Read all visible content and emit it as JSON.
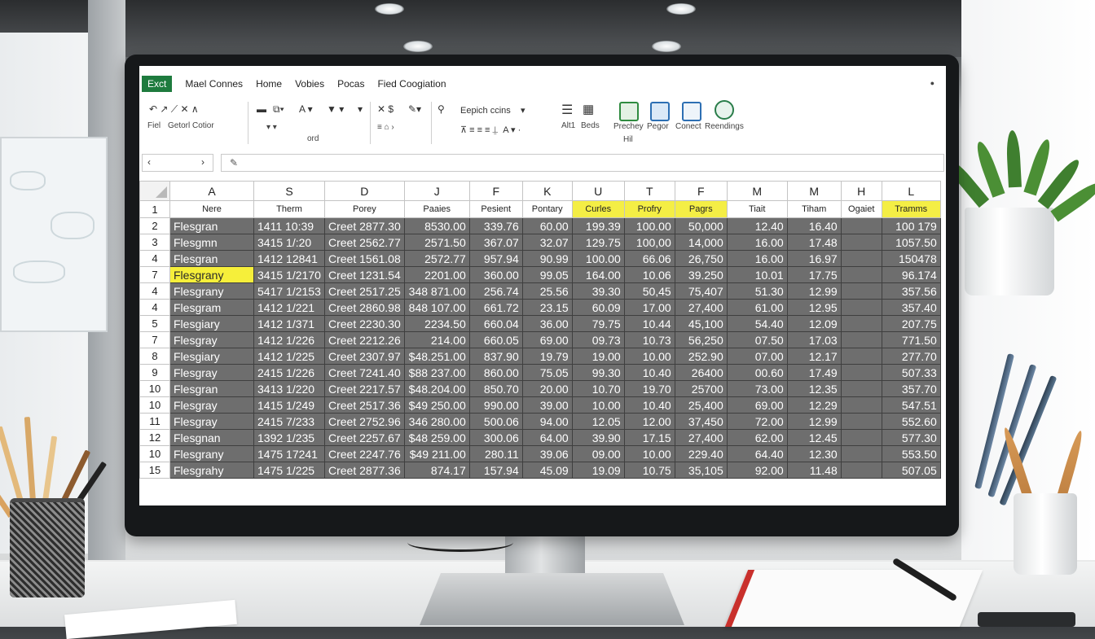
{
  "colors": {
    "sheet_cell": "#6e6e6e",
    "highlight": "#f4ee45",
    "excel_green": "#1e7b3e"
  },
  "ribbon": {
    "app_tab": "Exct",
    "tabs": [
      "Mael Connes",
      "Home",
      "Vobies",
      "Pocas",
      "Fied Coogiation"
    ],
    "left_labels": [
      "Fiel",
      "Getorl Cotior"
    ],
    "group_label": "ord",
    "font_box": "Eepich ccins",
    "right_buttons": [
      "Alt1",
      "Beds",
      "Prechey",
      "Pegor",
      "Conect",
      "Reendings"
    ],
    "sub_label": "Hil"
  },
  "name_box_nav": {
    "left": "‹",
    "right": "›"
  },
  "grid": {
    "column_letters": [
      "A",
      "S",
      "D",
      "J",
      "F",
      "K",
      "U",
      "T",
      "F",
      "M",
      "M",
      "H",
      "L"
    ],
    "headers": [
      "Nere",
      "Therm",
      "Porey",
      "Paaies",
      "Pesient",
      "Pontary",
      "Curles",
      "Profry",
      "Pagrs",
      "Tiait",
      "Tiham",
      "Ogaiet",
      "Tramms"
    ],
    "highlighted_headers": [
      6,
      7,
      8,
      12
    ],
    "header_row_num": "1",
    "rows": [
      {
        "num": "2",
        "cells": [
          "Flesgran",
          "1411 10:39",
          "Creet 2877.30",
          "8530.00",
          "339.76",
          "60.00",
          "199.39",
          "100.00",
          "50,000",
          "12.40",
          "16.40",
          "",
          "100 179"
        ]
      },
      {
        "num": "3",
        "cells": [
          "Flesgmn",
          "3415 1/:20",
          "Creet 2562.77",
          "2571.50",
          "367.07",
          "32.07",
          "129.75",
          "100,00",
          "14,000",
          "16.00",
          "17.48",
          "",
          "1057.50"
        ]
      },
      {
        "num": "4",
        "cells": [
          "Flesgran",
          "1412 12841",
          "Creet 1561.08",
          "2572.77",
          "957.94",
          "90.99",
          "100.00",
          "66.06",
          "26,750",
          "16.00",
          "16.97",
          "",
          "150478"
        ]
      },
      {
        "num": "7",
        "cells": [
          "Flesgrany",
          "3415 1/2170",
          "Creet 1231.54",
          "2201.00",
          "360.00",
          "99.05",
          "164.00",
          "10.06",
          "39.250",
          "10.01",
          "17.75",
          "",
          "96.174"
        ],
        "highlight_first": true
      },
      {
        "num": "4",
        "cells": [
          "Flesgrany",
          "5417 1/2153",
          "Creet 2517.25",
          "348 871.00",
          "256.74",
          "25.56",
          "39.30",
          "50,45",
          "75,407",
          "51.30",
          "12.99",
          "",
          "357.56"
        ]
      },
      {
        "num": "4",
        "cells": [
          "Flesgram",
          "1412 1/221",
          "Creet 2860.98",
          "848 107.00",
          "661.72",
          "23.15",
          "60.09",
          "17.00",
          "27,400",
          "61.00",
          "12.95",
          "",
          "357.40"
        ]
      },
      {
        "num": "5",
        "cells": [
          "Flesgiary",
          "1412 1/371",
          "Creet 2230.30",
          "2234.50",
          "660.04",
          "36.00",
          "79.75",
          "10.44",
          "45,100",
          "54.40",
          "12.09",
          "",
          "207.75"
        ]
      },
      {
        "num": "7",
        "cells": [
          "Flesgray",
          "1412 1/226",
          "Creet 2212.26",
          "214.00",
          "660.05",
          "69.00",
          "09.73",
          "10.73",
          "56,250",
          "07.50",
          "17.03",
          "",
          "771.50"
        ]
      },
      {
        "num": "8",
        "cells": [
          "Flesgiary",
          "1412 1/225",
          "Creet 2307.97",
          "$48.251.00",
          "837.90",
          "19.79",
          "19.00",
          "10.00",
          "252.90",
          "07.00",
          "12.17",
          "",
          "277.70"
        ]
      },
      {
        "num": "9",
        "cells": [
          "Flesgray",
          "2415 1/226",
          "Creet 7241.40",
          "$88 237.00",
          "860.00",
          "75.05",
          "99.30",
          "10.40",
          "26400",
          "00.60",
          "17.49",
          "",
          "507.33"
        ]
      },
      {
        "num": "10",
        "cells": [
          "Flesgran",
          "3413 1/220",
          "Creet 2217.57",
          "$48.204.00",
          "850.70",
          "20.00",
          "10.70",
          "19.70",
          "25700",
          "73.00",
          "12.35",
          "",
          "357.70"
        ]
      },
      {
        "num": "10",
        "cells": [
          "Flesgray",
          "1415 1/249",
          "Creet 2517.36",
          "$49 250.00",
          "990.00",
          "39.00",
          "10.00",
          "10.40",
          "25,400",
          "69.00",
          "12.29",
          "",
          "547.51"
        ]
      },
      {
        "num": "11",
        "cells": [
          "Flesgray",
          "2415 7/233",
          "Creet 2752.96",
          "346 280.00",
          "500.06",
          "94.00",
          "12.05",
          "12.00",
          "37,450",
          "72.00",
          "12.99",
          "",
          "552.60"
        ]
      },
      {
        "num": "12",
        "cells": [
          "Flesgnan",
          "1392 1/235",
          "Creet 2257.67",
          "$48 259.00",
          "300.06",
          "64.00",
          "39.90",
          "17.15",
          "27,400",
          "62.00",
          "12.45",
          "",
          "577.30"
        ]
      },
      {
        "num": "10",
        "cells": [
          "Flesgrany",
          "1475 17241",
          "Creet 2247.76",
          "$49 211.00",
          "280.11",
          "39.06",
          "09.00",
          "10.00",
          "229.40",
          "64.40",
          "12.30",
          "",
          "553.50"
        ]
      },
      {
        "num": "15",
        "cells": [
          "Flesgrahy",
          "1475 1/225",
          "Creet 2877.36",
          "874.17",
          "157.94",
          "45.09",
          "19.09",
          "10.75",
          "35,105",
          "92.00",
          "11.48",
          "",
          "507.05"
        ]
      }
    ]
  }
}
